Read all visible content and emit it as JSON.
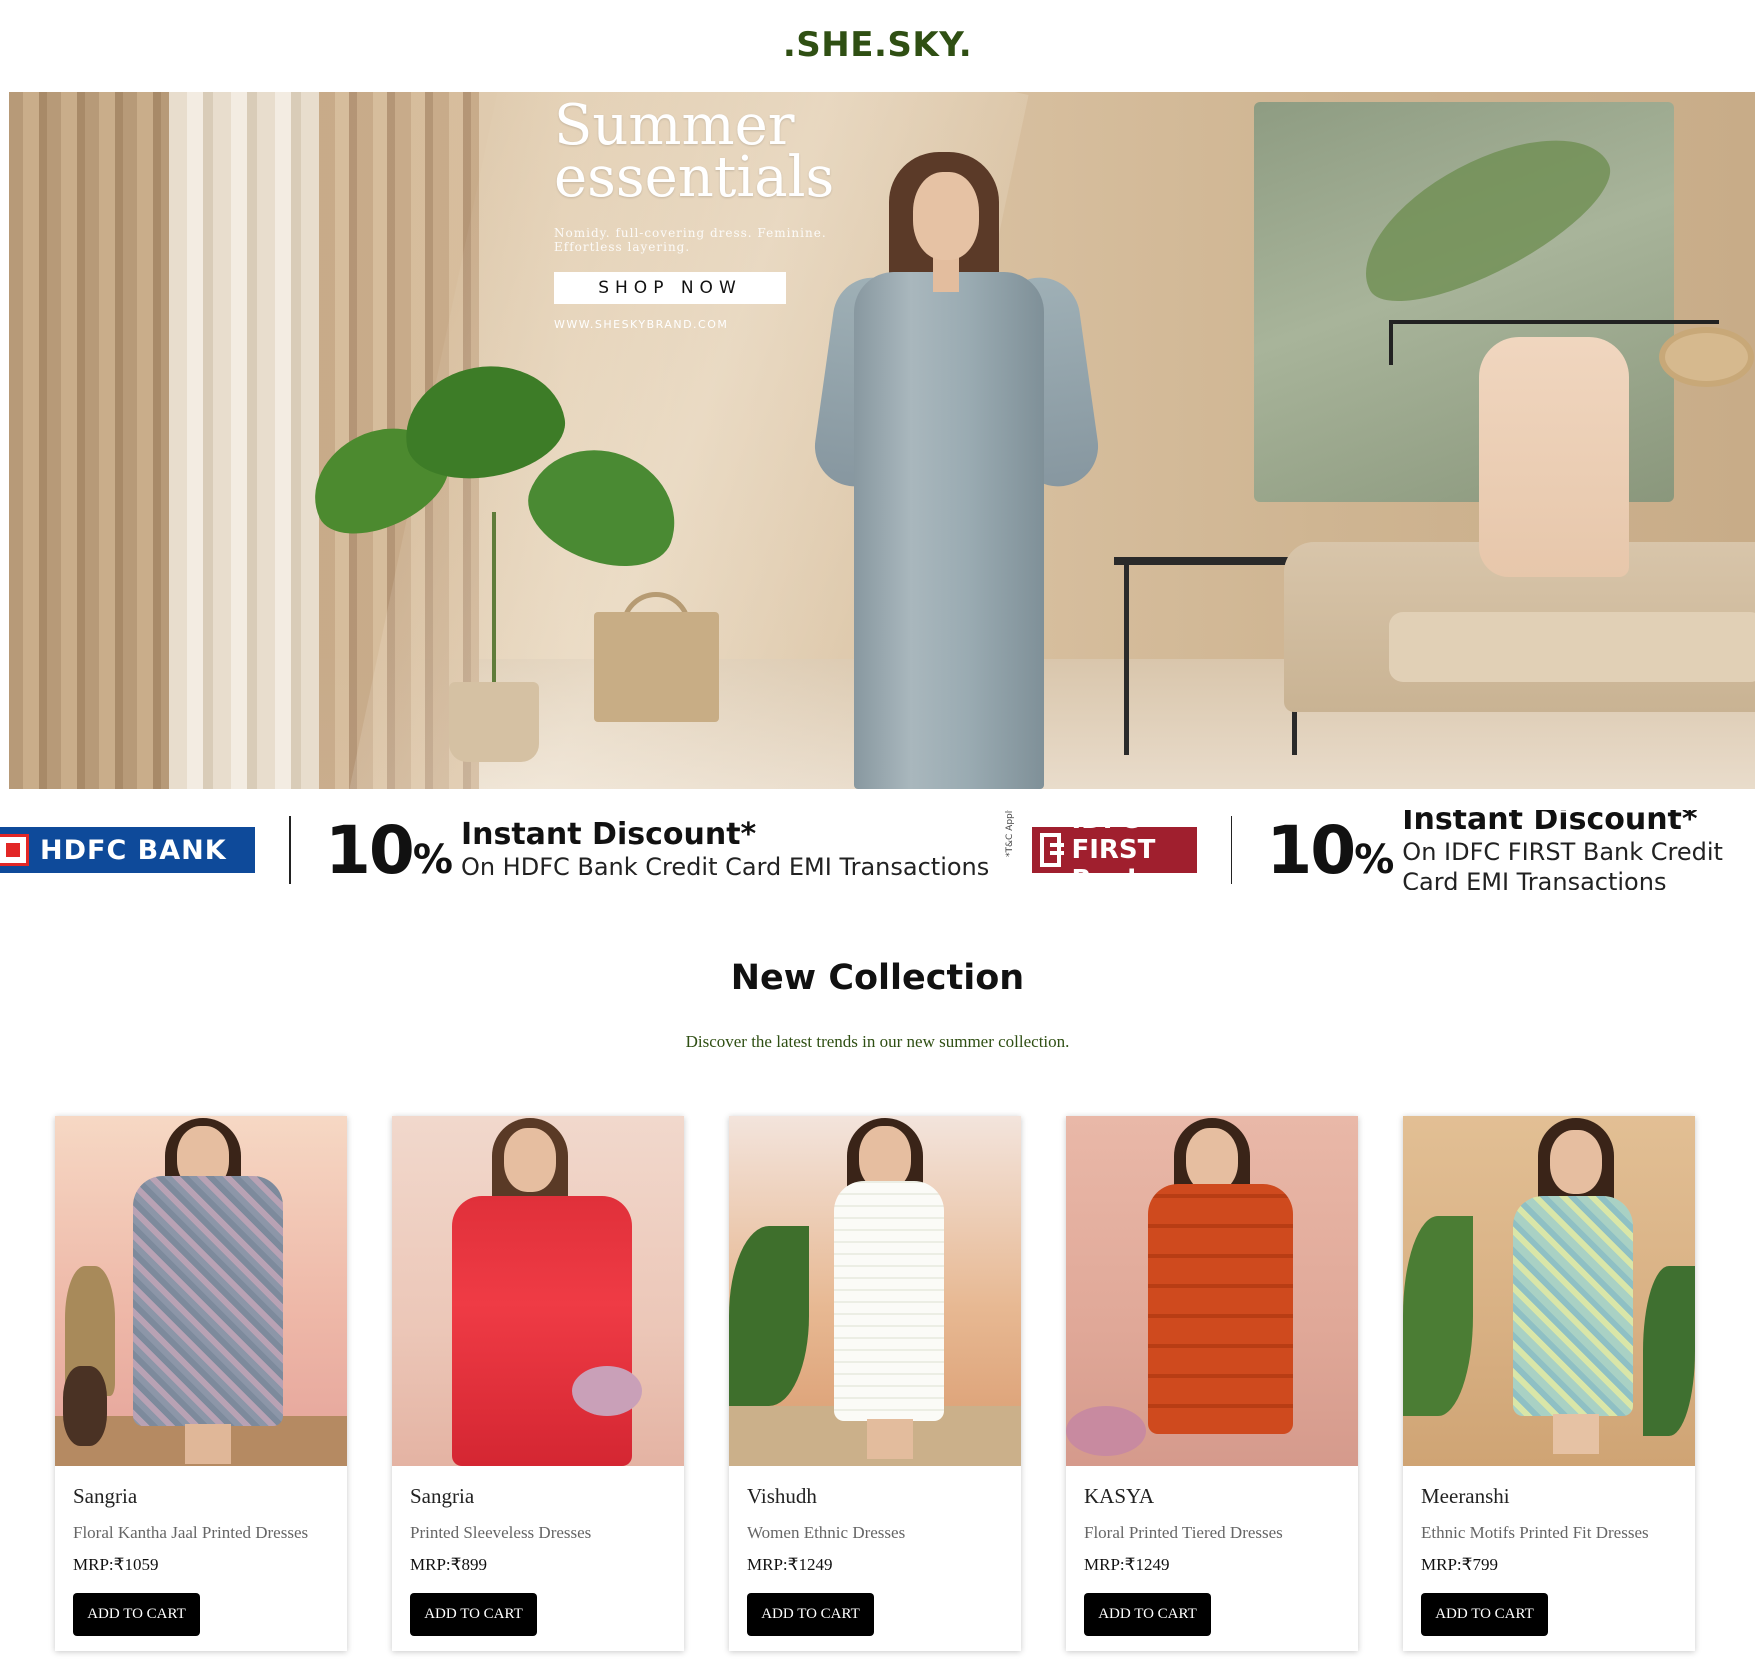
{
  "brand": {
    "logo": ".SHE.SKY."
  },
  "hero": {
    "title_line1": "Summer",
    "title_line2": "essentials",
    "subtitle": "Nomidy. full-covering dress. Feminine. Effortless layering.",
    "button_label": "SHOP NOW",
    "url_text": "WWW.SHESKYBRAND.COM"
  },
  "offers": [
    {
      "bank": "HDFC BANK",
      "percent": "10",
      "percent_sign": "%",
      "headline": "Instant Discount*",
      "detail": "On HDFC Bank Credit Card EMI Transactions"
    },
    {
      "bank": "IDFC FIRST Bank",
      "percent": "10",
      "percent_sign": "%",
      "headline": "Instant Discount*",
      "detail": "On IDFC FIRST Bank Credit Card EMI Transactions",
      "tnc": "*T&C Apply"
    }
  ],
  "collection": {
    "title": "New Collection",
    "subtitle": "Discover the latest trends in our new summer collection.",
    "products": [
      {
        "brand": "Sangria",
        "desc": "Floral Kantha Jaal Printed Dresses",
        "price": "MRP:₹1059",
        "button": "ADD TO CART"
      },
      {
        "brand": "Sangria",
        "desc": "Printed Sleeveless Dresses",
        "price": "MRP:₹899",
        "button": "ADD TO CART"
      },
      {
        "brand": "Vishudh",
        "desc": "Women Ethnic Dresses",
        "price": "MRP:₹1249",
        "button": "ADD TO CART"
      },
      {
        "brand": "KASYA",
        "desc": "Floral Printed Tiered Dresses",
        "price": "MRP:₹1249",
        "button": "ADD TO CART"
      },
      {
        "brand": "Meeranshi",
        "desc": "Ethnic Motifs Printed Fit Dresses",
        "price": "MRP:₹799",
        "button": "ADD TO CART"
      }
    ]
  },
  "colors": {
    "brand_green": "#2f4f13",
    "hdfc_blue": "#0e4a9a",
    "hdfc_red": "#e22726",
    "idfc_red": "#a01f2e",
    "button_black": "#000000"
  }
}
